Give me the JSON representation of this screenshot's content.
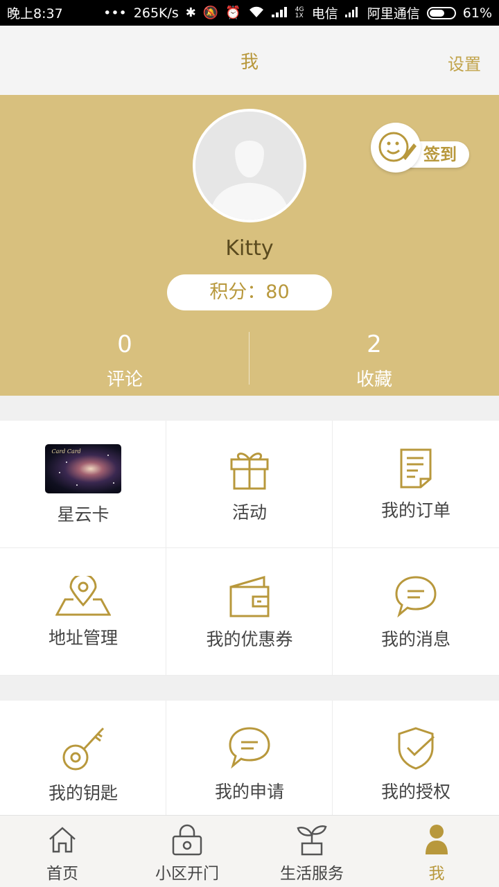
{
  "status_bar": {
    "time": "晚上8:37",
    "dots": "•••",
    "speed": "265K/s",
    "network_tag": "4G 1X",
    "carrier1": "电信",
    "carrier2": "阿里通信",
    "battery": "61%",
    "battery_level": 0.61
  },
  "header": {
    "title": "我",
    "settings": "设置"
  },
  "profile": {
    "username": "Kitty",
    "points_label": "积分：80",
    "checkin_label": "签到",
    "stats": [
      {
        "value": "0",
        "label": "评论"
      },
      {
        "value": "2",
        "label": "收藏"
      }
    ]
  },
  "grid1": [
    {
      "label": "星云卡",
      "icon": "nebula-card-image"
    },
    {
      "label": "活动",
      "icon": "gift-icon"
    },
    {
      "label": "我的订单",
      "icon": "order-document-icon"
    },
    {
      "label": "地址管理",
      "icon": "map-pin-icon"
    },
    {
      "label": "我的优惠券",
      "icon": "wallet-icon"
    },
    {
      "label": "我的消息",
      "icon": "chat-bubble-icon"
    }
  ],
  "grid2": [
    {
      "label": "我的钥匙",
      "icon": "key-icon"
    },
    {
      "label": "我的申请",
      "icon": "chat-bubble-icon"
    },
    {
      "label": "我的授权",
      "icon": "shield-check-icon"
    }
  ],
  "bottom_nav": [
    {
      "label": "首页",
      "icon": "home-icon"
    },
    {
      "label": "小区开门",
      "icon": "lock-icon"
    },
    {
      "label": "生活服务",
      "icon": "plant-icon"
    },
    {
      "label": "我",
      "icon": "person-icon",
      "active": true
    }
  ],
  "colors": {
    "accent": "#b8983c",
    "profile_bg": "#d8c07e"
  }
}
